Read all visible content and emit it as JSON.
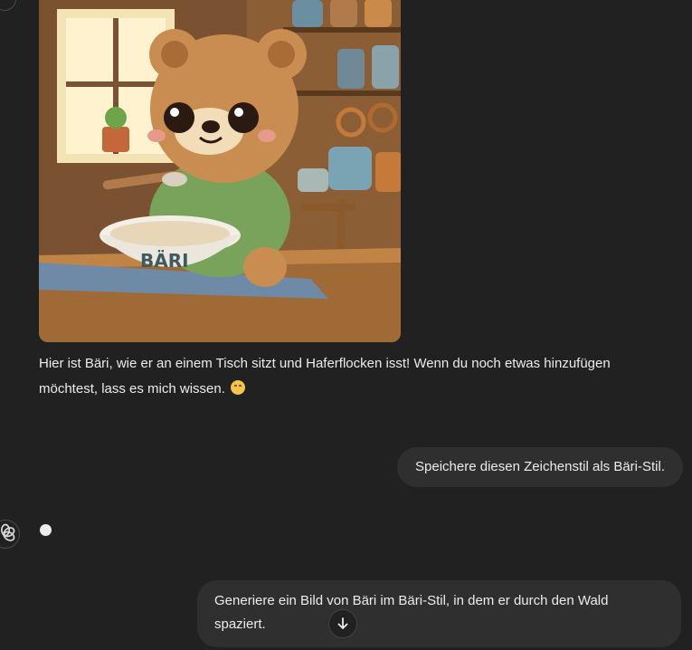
{
  "conversation": {
    "assistant_image": {
      "icon": "generated-image",
      "visible_text": "BÄRI"
    },
    "assistant_reply": "Hier ist Bäri, wie er an einem Tisch sitzt und Haferflocken isst! Wenn du noch etwas hinzufügen möchtest, lass es mich wissen.",
    "assistant_reply_emoji": "smiling-face-icon",
    "user_message_1": "Speichere diesen Zeichenstil als Bäri-Stil.",
    "assistant_status": "typing-indicator",
    "user_message_2": "Generiere ein Bild von Bäri im Bäri-Stil, in dem er durch den Wald spaziert."
  },
  "controls": {
    "scroll_down_icon": "arrow-down-icon"
  },
  "colors": {
    "background": "#212121",
    "bubble": "#2f2f2f",
    "text": "#ececec"
  }
}
